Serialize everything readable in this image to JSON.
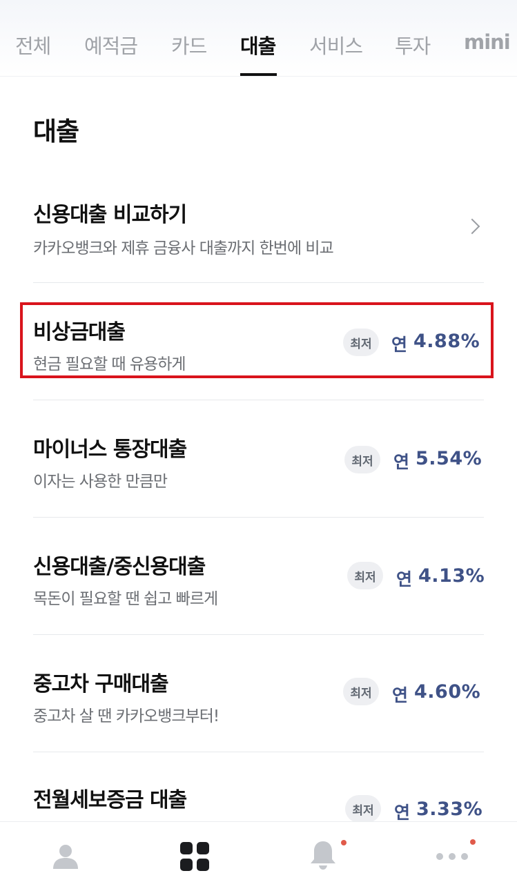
{
  "tabs": [
    {
      "label": "전체"
    },
    {
      "label": "예적금"
    },
    {
      "label": "카드"
    },
    {
      "label": "대출",
      "active": true
    },
    {
      "label": "서비스"
    },
    {
      "label": "투자"
    },
    {
      "label": "mini"
    }
  ],
  "page_title": "대출",
  "compare": {
    "title": "신용대출 비교하기",
    "subtitle": "카카오뱅크와 제휴 금융사 대출까지 한번에 비교"
  },
  "products": [
    {
      "title": "비상금대출",
      "subtitle": "현금 필요할 때 유용하게",
      "badge": "최저",
      "rate_prefix": "연",
      "rate": "4.88%"
    },
    {
      "title": "마이너스 통장대출",
      "subtitle": "이자는 사용한 만큼만",
      "badge": "최저",
      "rate_prefix": "연",
      "rate": "5.54%"
    },
    {
      "title": "신용대출/중신용대출",
      "subtitle": "목돈이 필요할 땐 쉽고 빠르게",
      "badge": "최저",
      "rate_prefix": "연",
      "rate": "4.13%"
    },
    {
      "title": "중고차 구매대출",
      "subtitle": "중고차 살 땐 카카오뱅크부터!",
      "badge": "최저",
      "rate_prefix": "연",
      "rate": "4.60%"
    },
    {
      "title": "전월세보증금 대출",
      "subtitle": "",
      "badge": "최저",
      "rate_prefix": "연",
      "rate": "3.33%"
    }
  ],
  "bottom_nav": [
    {
      "icon": "person-icon"
    },
    {
      "icon": "grid-icon",
      "active": true
    },
    {
      "icon": "bell-icon",
      "notification": true
    },
    {
      "icon": "more-icon",
      "notification": true
    }
  ],
  "colors": {
    "rate": "#3f5287",
    "highlight": "#d9141c",
    "notification_dot": "#e05a4a"
  }
}
